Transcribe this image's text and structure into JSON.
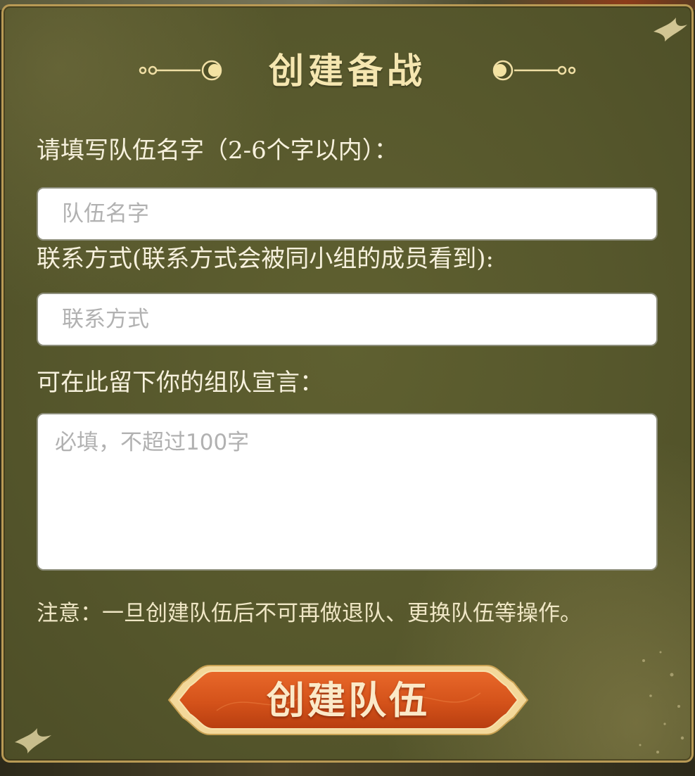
{
  "dialog": {
    "title": "创建备战"
  },
  "form": {
    "team_name": {
      "label": "请填写队伍名字（2-6个字以内）：",
      "placeholder": "队伍名字",
      "value": ""
    },
    "contact": {
      "label": "联系方式(联系方式会被同小组的成员看到):",
      "placeholder": "联系方式",
      "value": ""
    },
    "declaration": {
      "label": "可在此留下你的组队宣言：",
      "placeholder": "必填，不超过100字",
      "value": ""
    }
  },
  "notice": "注意：一旦创建队伍后不可再做退队、更换队伍等操作。",
  "submit_button": {
    "label": "创建队伍"
  },
  "colors": {
    "panel_background": "#56572c",
    "panel_border": "#b99a55",
    "title_text": "#f5e6b0",
    "button_fill": "#d4561a"
  }
}
